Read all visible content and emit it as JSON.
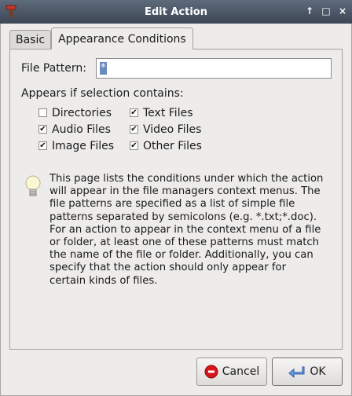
{
  "window": {
    "title": "Edit Action",
    "controls": [
      "↑",
      "□",
      "×"
    ]
  },
  "tabs": [
    {
      "label": "Basic",
      "active": false
    },
    {
      "label": "Appearance Conditions",
      "active": true
    }
  ],
  "pattern": {
    "label": "File Pattern:",
    "value": "*"
  },
  "appears_label": "Appears if selection contains:",
  "checks": [
    {
      "label": "Directories",
      "checked": false
    },
    {
      "label": "Text Files",
      "checked": true
    },
    {
      "label": "Audio Files",
      "checked": true
    },
    {
      "label": "Video Files",
      "checked": true
    },
    {
      "label": "Image Files",
      "checked": true
    },
    {
      "label": "Other Files",
      "checked": true
    }
  ],
  "info": "This page lists the conditions under which the action will appear in the file managers context menus. The file patterns are specified as a list of simple file patterns separated by semicolons (e.g. *.txt;*.doc). For an action to appear in the context menu of a file or folder, at least one of these patterns must match the name of the file or folder. Additionally, you can specify that the action should only appear for certain kinds of files.",
  "buttons": {
    "cancel": "Cancel",
    "ok": "OK"
  },
  "colors": {
    "titlebar": "#4a5565",
    "selection": "#6a8bb9",
    "cancel_icon": "#d8161b",
    "ok_icon": "#3a6fc4"
  },
  "icons": {
    "app": "red-brush-icon",
    "info": "lightbulb-icon",
    "cancel": "stop-icon",
    "ok": "enter-arrow-icon"
  }
}
